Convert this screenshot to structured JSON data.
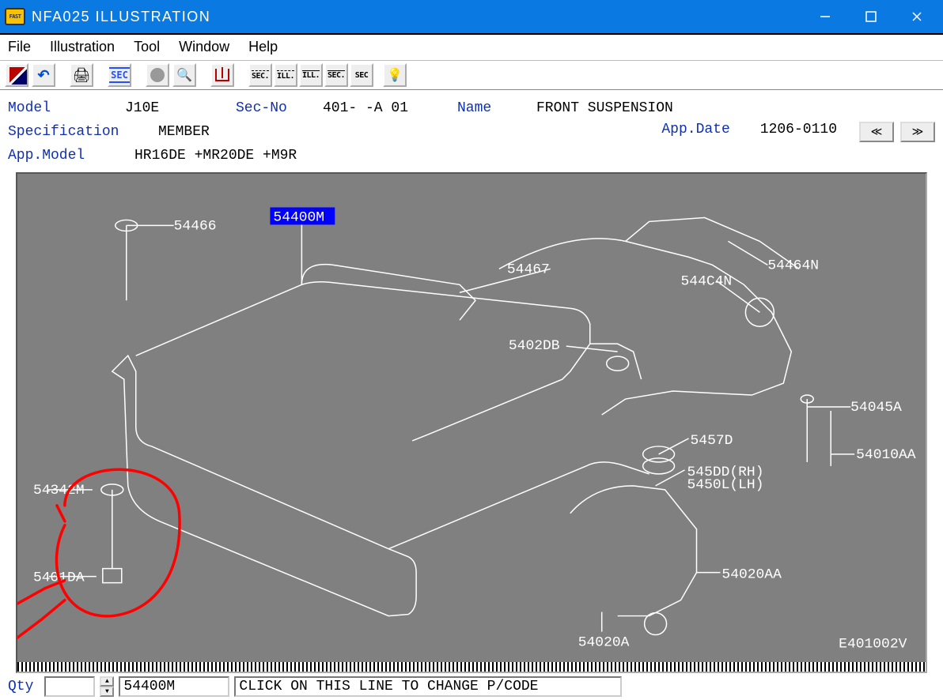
{
  "window": {
    "title": "NFA025  ILLUSTRATION",
    "icon_caption": "FAST"
  },
  "menu": {
    "file": "File",
    "illustration": "Illustration",
    "tool": "Tool",
    "window": "Window",
    "help": "Help"
  },
  "toolbar": {
    "sec_label": "SEC",
    "nav_sec_back": "SEC.",
    "nav_ill_back": "ILL.",
    "nav_ill_fwd": "ILL.",
    "nav_sec_fwd": "SEC.",
    "nav_sec": "SEC"
  },
  "info": {
    "model_label": "Model",
    "model_value": "J10E",
    "secno_label": "Sec-No",
    "secno_value": "401-  -A 01",
    "name_label": "Name",
    "name_value": "FRONT SUSPENSION",
    "spec_label": "Specification",
    "spec_value": "MEMBER",
    "appdate_label": "App.Date",
    "appdate_value": "1206-0110",
    "appmodel_label": "App.Model",
    "appmodel_value": "HR16DE +MR20DE +M9R"
  },
  "diagram": {
    "selected_code": "54400M",
    "labels": {
      "l54466": "54466",
      "l54467": "54467",
      "l544C4N": "544C4N",
      "l54464N": "54464N",
      "l5402DB": "5402DB",
      "l54045A": "54045A",
      "l5457D": "5457D",
      "l54010AA": "54010AA",
      "l545DD": "545DD(RH)",
      "l5450L": "5450L(LH)",
      "l54020AA": "54020AA",
      "l54020A": "54020A",
      "l54342M": "54342M",
      "l54010A": "5401DA"
    },
    "drawing_id": "E401002V"
  },
  "status": {
    "qty_label": "Qty",
    "qty_value": "",
    "pcode_value": "54400M",
    "instruction": "CLICK ON THIS LINE TO CHANGE P/CODE"
  }
}
